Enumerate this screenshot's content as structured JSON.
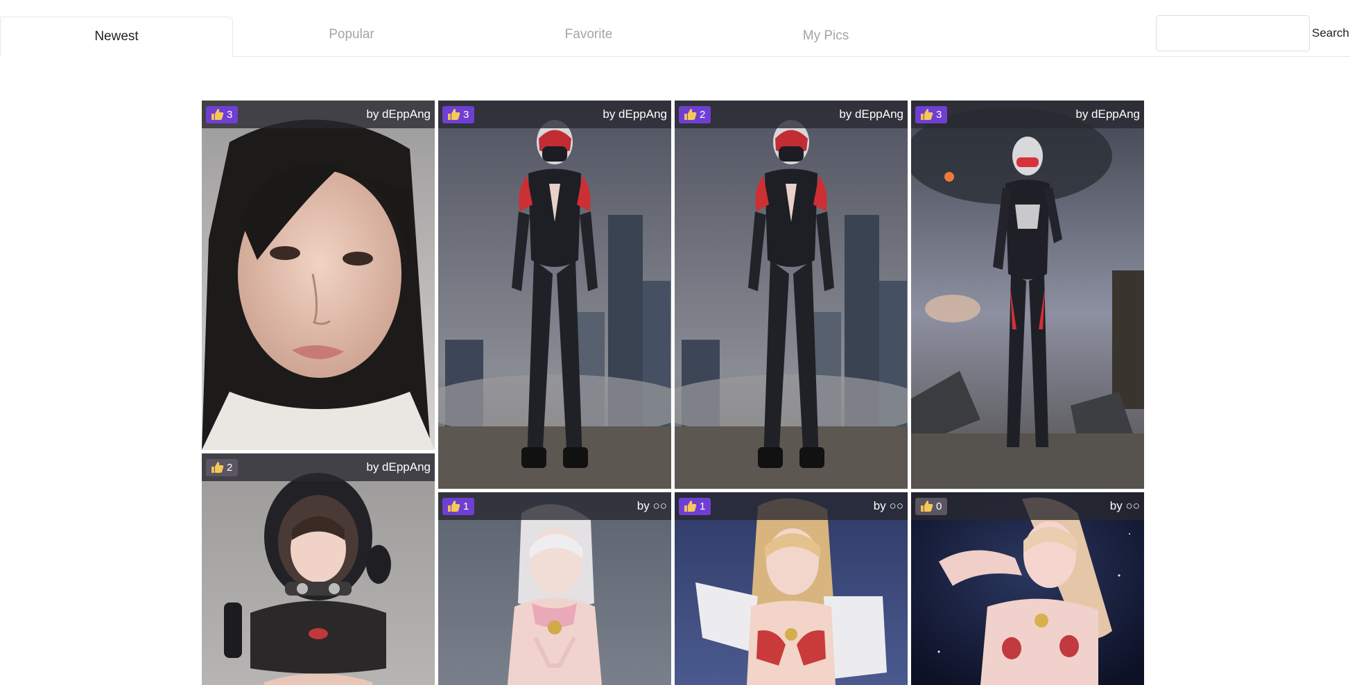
{
  "tabs": [
    {
      "label": "Newest",
      "active": true
    },
    {
      "label": "Popular",
      "active": false
    },
    {
      "label": "Favorite",
      "active": false
    },
    {
      "label": "My Pics",
      "active": false
    }
  ],
  "search": {
    "value": "",
    "placeholder": "",
    "button_label": "Search"
  },
  "colors": {
    "like_badge": "#6f3fd2",
    "like_badge_zero": "#5a5560",
    "overlay": "rgba(40,40,48,0.78)"
  },
  "gallery": {
    "cards": [
      {
        "likes": "3",
        "author": "by dEppAng",
        "scene": "portrait-girl"
      },
      {
        "likes": "3",
        "author": "by dEppAng",
        "scene": "armored-figure-city"
      },
      {
        "likes": "2",
        "author": "by dEppAng",
        "scene": "armored-figure-city"
      },
      {
        "likes": "3",
        "author": "by dEppAng",
        "scene": "armored-figure-wasteland"
      },
      {
        "likes": "2",
        "author": "by dEppAng",
        "scene": "spacesuit-girl"
      },
      {
        "likes": "1",
        "author": "by ○○",
        "scene": "white-hair-girl"
      },
      {
        "likes": "1",
        "author": "by ○○",
        "scene": "blonde-girl-blue"
      },
      {
        "likes": "0",
        "author": "by ○○",
        "scene": "blonde-girl-dark"
      }
    ]
  }
}
